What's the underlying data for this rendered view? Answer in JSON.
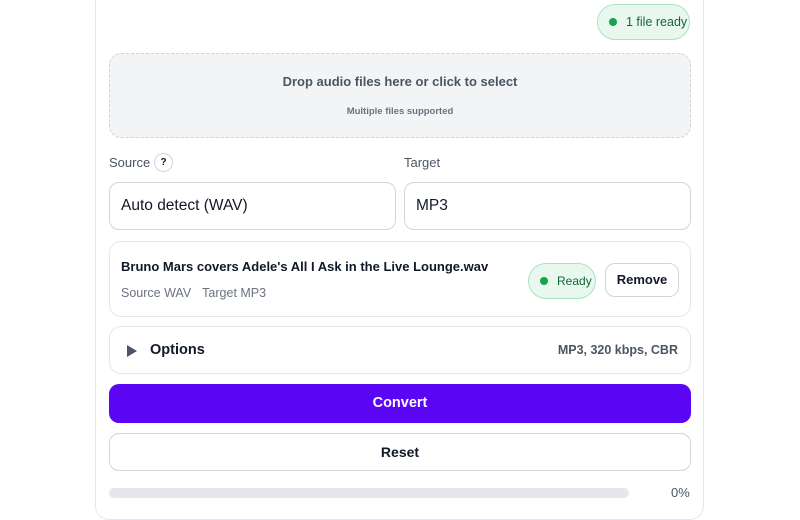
{
  "status": {
    "files_ready": "1 file ready"
  },
  "dropzone": {
    "title": "Drop audio files here or click to select",
    "subtitle": "Multiple files supported"
  },
  "source": {
    "label": "Source",
    "help_glyph": "?",
    "value": "Auto detect (WAV)"
  },
  "target": {
    "label": "Target",
    "value": "MP3"
  },
  "file": {
    "name": "Bruno Mars covers Adele's All I Ask in the Live Lounge.wav",
    "source_meta": "Source WAV",
    "target_meta": "Target MP3",
    "status": "Ready",
    "remove_label": "Remove"
  },
  "options": {
    "label": "Options",
    "summary": "MP3, 320 kbps, CBR",
    "icon": "play-caret-icon"
  },
  "actions": {
    "convert_label": "Convert",
    "reset_label": "Reset"
  },
  "progress": {
    "value_percent": 0,
    "label": "0%"
  },
  "colors": {
    "accent": "#5b05f5",
    "ready_bg": "#e8f8ef",
    "ready_dot": "#16a34a"
  }
}
